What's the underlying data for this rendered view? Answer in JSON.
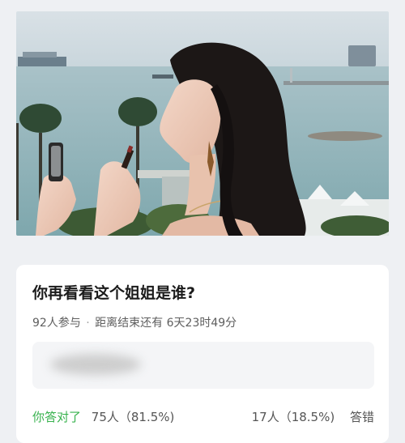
{
  "poll": {
    "question": "你再看看这个姐姐是谁?",
    "participants": "92人参与",
    "separator": "·",
    "countdown": "距离结束还有 6天23时49分",
    "results": {
      "correct_label": "你答对了",
      "correct_stats": "75人（81.5%)",
      "wrong_stats": "17人（18.5%)",
      "wrong_label": "答错"
    }
  },
  "colors": {
    "background": "#eef0f3",
    "card": "#ffffff",
    "correct": "#37b24d"
  },
  "icons": [
    "lipstick-image",
    "mirror-image"
  ]
}
